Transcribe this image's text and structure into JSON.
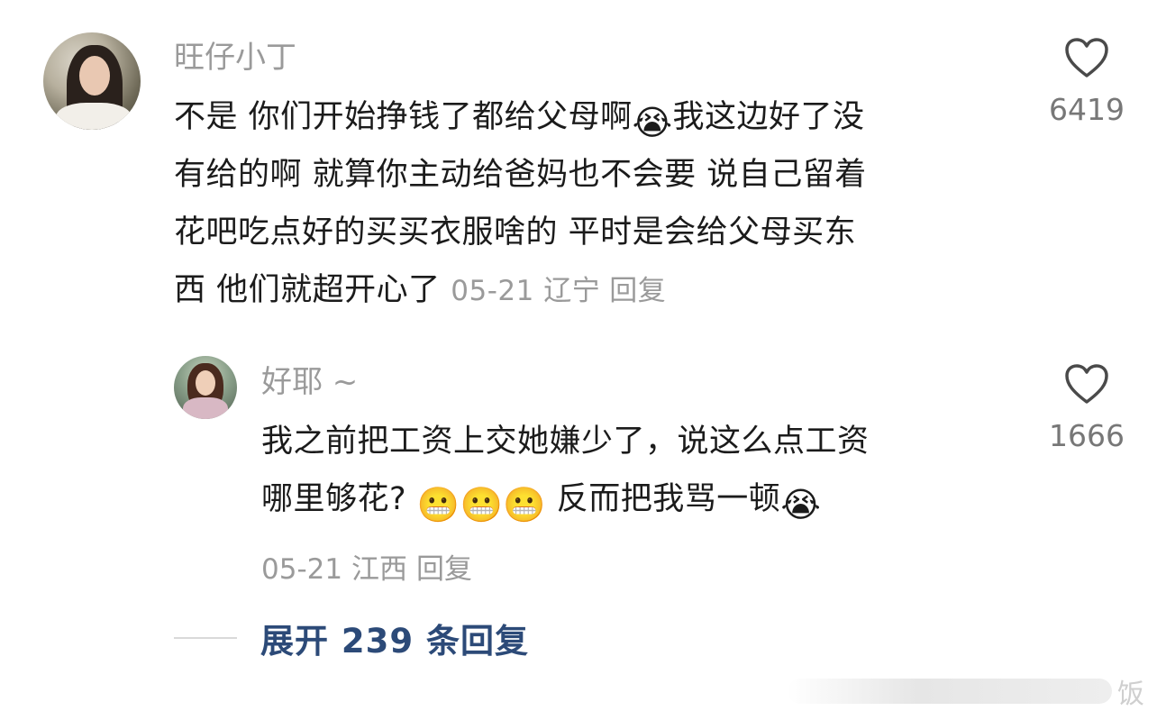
{
  "comments": [
    {
      "username": "旺仔小丁",
      "text_line1": "不是 你们开始挣钱了都给父母啊",
      "emoji1": "😭",
      "text_line1_after": "我这边好了没",
      "text_line2": "有给的啊  就算你主动给爸妈也不会要 说自己留着",
      "text_line3": "花吧吃点好的买买衣服啥的   平时是会给父母买东",
      "text_line4": "西  他们就超开心了",
      "date": "05-21",
      "location": "辽宁",
      "reply_label": "回复",
      "likes": "6419"
    },
    {
      "username": "好耶 ~",
      "text_line1": "我之前把工资上交她嫌少了，说这么点工资",
      "text_line2": "哪里够花?",
      "emoji_group": "😬😬😬",
      "text_line2_after": "  反而把我骂一顿",
      "emoji_end": "😭",
      "date": "05-21",
      "location": "江西",
      "reply_label": "回复",
      "likes": "1666"
    }
  ],
  "expand_label": "展开 239 条回复",
  "watermark_text": "饭",
  "icons": {
    "like": "heart-outline-icon"
  }
}
